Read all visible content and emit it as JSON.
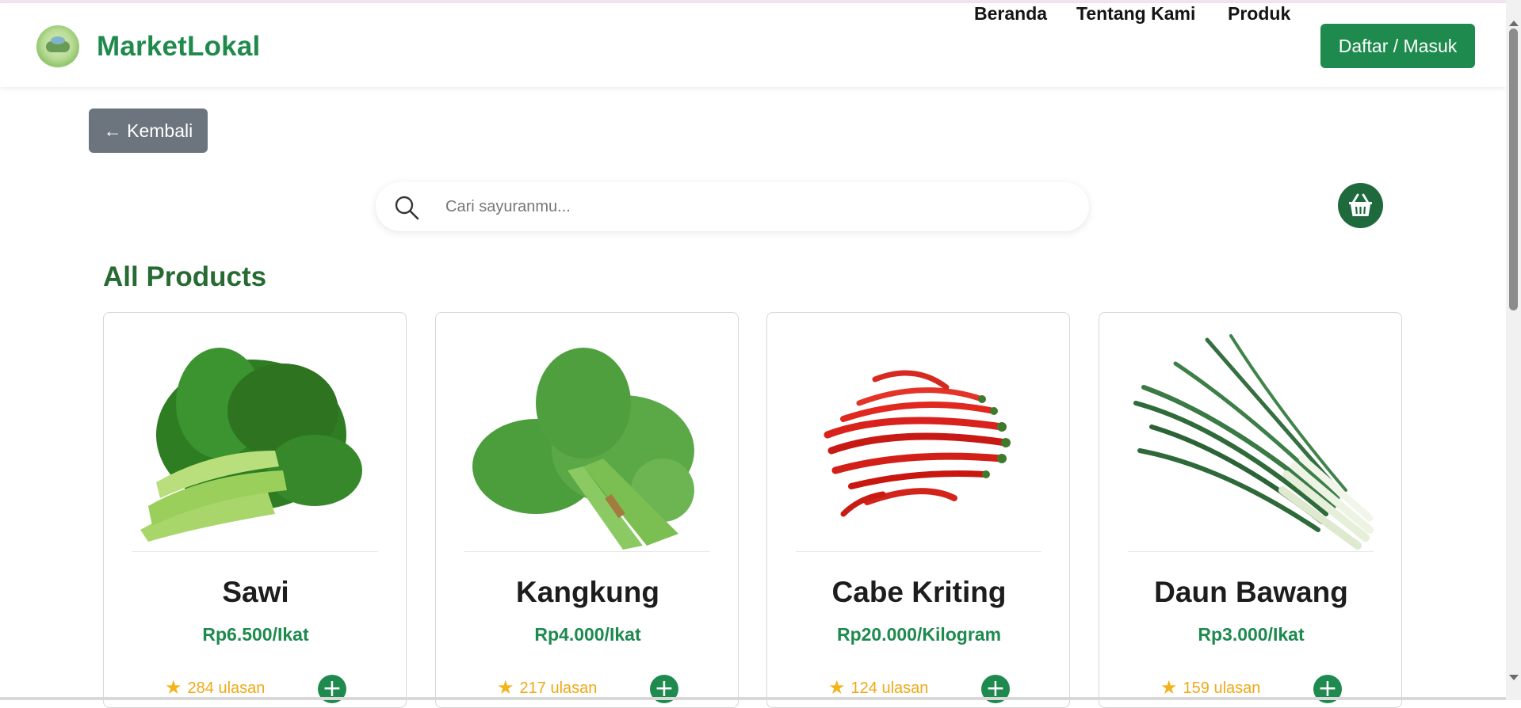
{
  "header": {
    "brand_name": "MarketLokal",
    "nav": {
      "home": "Beranda",
      "about": "Tentang Kami",
      "products": "Produk"
    },
    "login_label": "Daftar / Masuk"
  },
  "back_label": "← Kembali",
  "search": {
    "placeholder": "Cari sayuranmu..."
  },
  "section_title": "All Products",
  "colors": {
    "brand_green": "#1e8a4e",
    "title_green": "#276b33",
    "star": "#f3b31a",
    "back_gray": "#6c747d",
    "cart_bg": "#1f6a3c"
  },
  "products": [
    {
      "name": "Sawi",
      "price": "Rp6.500/Ikat",
      "reviews": "284 ulasan",
      "image": "sawi-vegetable-image"
    },
    {
      "name": "Kangkung",
      "price": "Rp4.000/Ikat",
      "reviews": "217 ulasan",
      "image": "kangkung-vegetable-image"
    },
    {
      "name": "Cabe Kriting",
      "price": "Rp20.000/Kilogram",
      "reviews": "124 ulasan",
      "image": "chili-pepper-image"
    },
    {
      "name": "Daun Bawang",
      "price": "Rp3.000/Ikat",
      "reviews": "159 ulasan",
      "image": "spring-onion-image"
    }
  ],
  "icons": {
    "search": "search-icon",
    "cart": "shopping-basket-icon",
    "star": "star-icon",
    "add": "plus-icon"
  }
}
